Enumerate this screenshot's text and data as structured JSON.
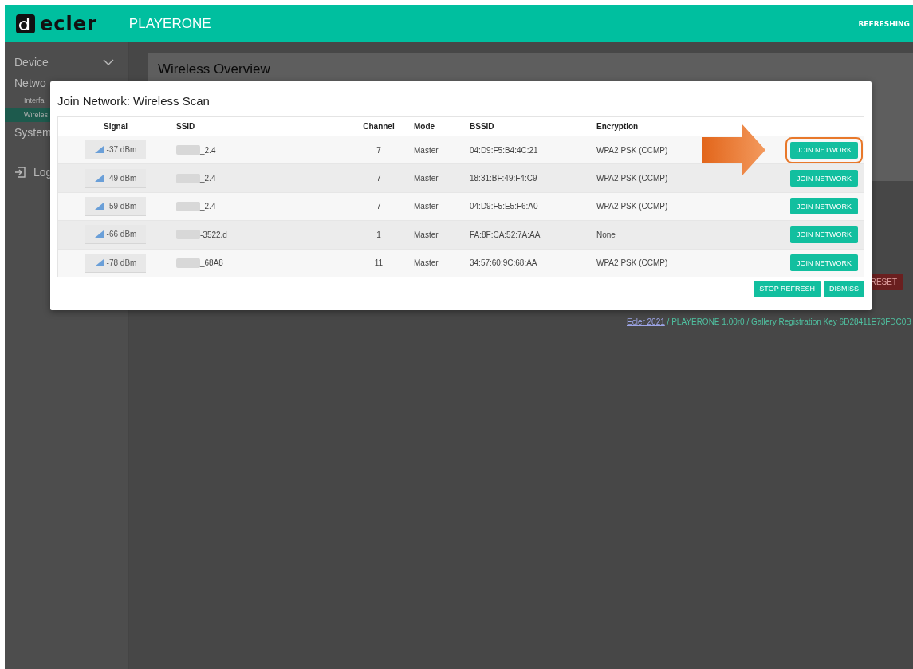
{
  "header": {
    "logo": "ecler",
    "title": "PLAYERONE",
    "status": "REFRESHING"
  },
  "sidebar": {
    "items": [
      {
        "label": "Device",
        "kind": "expandable",
        "selected": false
      },
      {
        "label": "Netwo",
        "kind": "group",
        "selected": false
      },
      {
        "label": "Interfa",
        "kind": "sub",
        "selected": false
      },
      {
        "label": "Wireles",
        "kind": "sub",
        "selected": true
      },
      {
        "label": "System",
        "kind": "group",
        "selected": false
      },
      {
        "label": "Log",
        "kind": "logout",
        "selected": false
      }
    ]
  },
  "main": {
    "heading": "Wireless Overview",
    "reset_button": "RESET",
    "footer": {
      "link": "Ecler 2021",
      "text": " / PLAYERONE 1.00r0 / Gallery Registration Key 6D28411E73FDC0B"
    }
  },
  "dialog": {
    "title": "Join Network: Wireless Scan",
    "columns": [
      "Signal",
      "SSID",
      "Channel",
      "Mode",
      "BSSID",
      "Encryption"
    ],
    "rows": [
      {
        "signal": "-37 dBm",
        "ssid": "_2.4",
        "channel": "7",
        "mode": "Master",
        "bssid": "04:D9:F5:B4:4C:21",
        "encryption": "WPA2 PSK (CCMP)",
        "action": "JOIN NETWORK",
        "highlighted": true
      },
      {
        "signal": "-49 dBm",
        "ssid": "_2.4",
        "channel": "7",
        "mode": "Master",
        "bssid": "18:31:BF:49:F4:C9",
        "encryption": "WPA2 PSK (CCMP)",
        "action": "JOIN NETWORK",
        "highlighted": false
      },
      {
        "signal": "-59 dBm",
        "ssid": "_2.4",
        "channel": "7",
        "mode": "Master",
        "bssid": "04:D9:F5:E5:F6:A0",
        "encryption": "WPA2 PSK (CCMP)",
        "action": "JOIN NETWORK",
        "highlighted": false
      },
      {
        "signal": "-66 dBm",
        "ssid": "-3522.d",
        "channel": "1",
        "mode": "Master",
        "bssid": "FA:8F:CA:52:7A:AA",
        "encryption": "None",
        "action": "JOIN NETWORK",
        "highlighted": false
      },
      {
        "signal": "-78 dBm",
        "ssid": "_68A8",
        "channel": "11",
        "mode": "Master",
        "bssid": "34:57:60:9C:68:AA",
        "encryption": "WPA2 PSK (CCMP)",
        "action": "JOIN NETWORK",
        "highlighted": false
      }
    ],
    "buttons": [
      "STOP REFRESH",
      "DISMISS"
    ]
  }
}
